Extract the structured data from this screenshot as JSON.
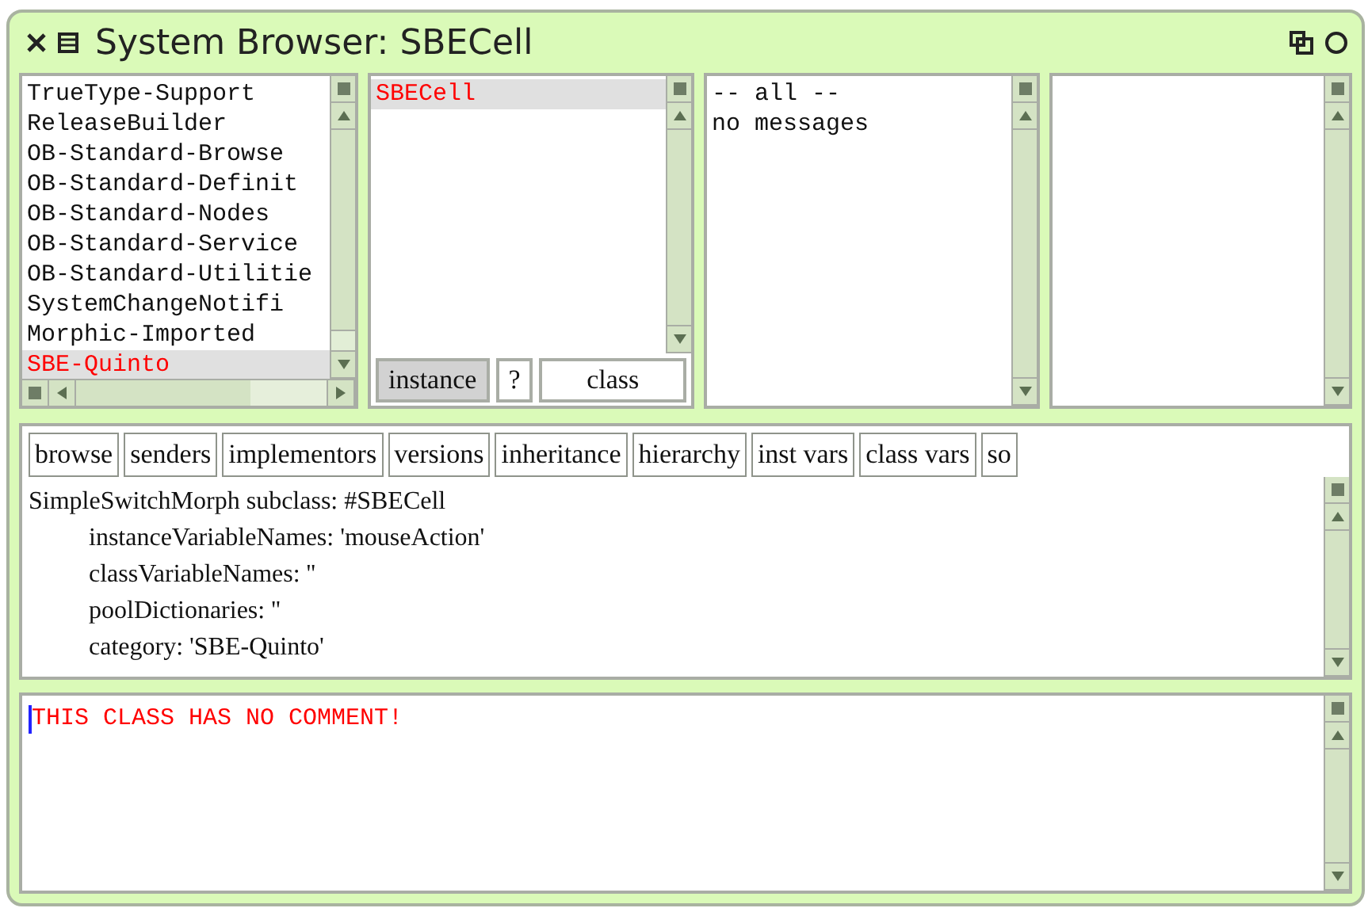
{
  "window": {
    "title": "System Browser: SBECell"
  },
  "packages": [
    {
      "label": "TrueType-Support",
      "selected": false
    },
    {
      "label": "ReleaseBuilder",
      "selected": false
    },
    {
      "label": "OB-Standard-Browse",
      "selected": false
    },
    {
      "label": "OB-Standard-Definit",
      "selected": false
    },
    {
      "label": "OB-Standard-Nodes",
      "selected": false
    },
    {
      "label": "OB-Standard-Service",
      "selected": false
    },
    {
      "label": "OB-Standard-Utilitie",
      "selected": false
    },
    {
      "label": "SystemChangeNotifi",
      "selected": false
    },
    {
      "label": "Morphic-Imported",
      "selected": false
    },
    {
      "label": "SBE-Quinto",
      "selected": true
    }
  ],
  "classes": [
    {
      "label": "SBECell",
      "selected": true
    }
  ],
  "side_buttons": [
    {
      "label": "instance",
      "selected": true
    },
    {
      "label": "?",
      "selected": false
    },
    {
      "label": "class",
      "selected": false
    }
  ],
  "protocols": [
    {
      "label": "-- all --",
      "selected": false
    },
    {
      "label": "no messages",
      "selected": false
    }
  ],
  "toolbar": [
    "browse",
    "senders",
    "implementors",
    "versions",
    "inheritance",
    "hierarchy",
    "inst vars",
    "class vars",
    "so"
  ],
  "definition": [
    {
      "text": "SimpleSwitchMorph subclass: #SBECell",
      "kind": "head"
    },
    {
      "text": "instanceVariableNames: 'mouseAction'",
      "kind": "indented"
    },
    {
      "text": "classVariableNames: ''",
      "kind": "indented"
    },
    {
      "text": "poolDictionaries: ''",
      "kind": "indented"
    },
    {
      "text": "category: 'SBE-Quinto'",
      "kind": "indented"
    }
  ],
  "comment": "THIS CLASS HAS NO COMMENT!"
}
